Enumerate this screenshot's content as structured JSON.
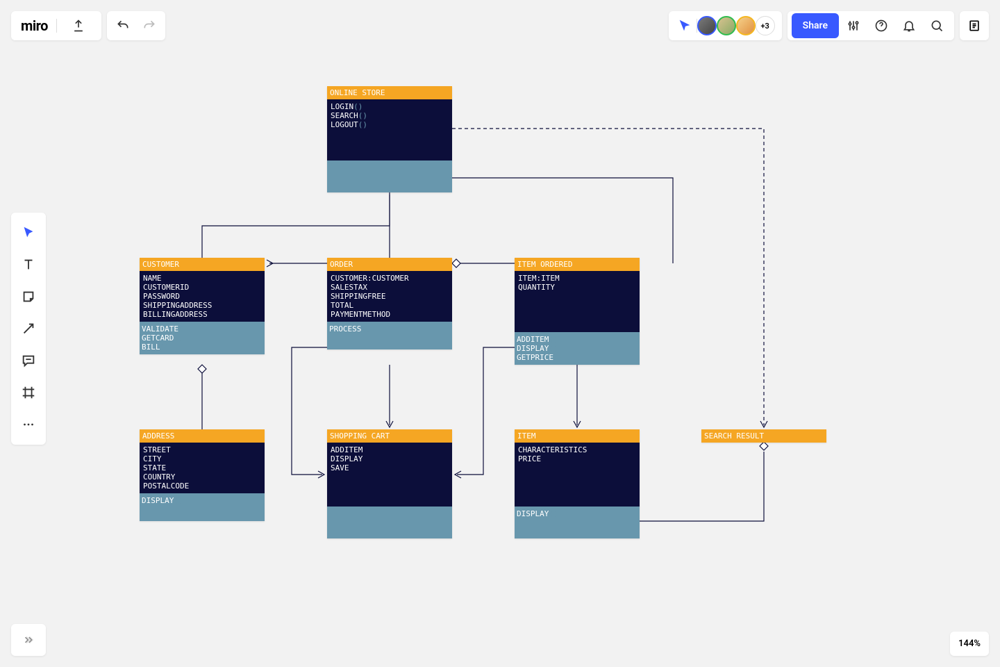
{
  "header": {
    "logo": "miro",
    "more_avatars": "+3",
    "share_label": "Share"
  },
  "zoom": "144%",
  "entities": {
    "online_store": {
      "title": "ONLINE STORE",
      "attrs": [
        "LOGIN()",
        "SEARCH()",
        "LOGOUT()"
      ],
      "methods": []
    },
    "customer": {
      "title": "CUSTOMER",
      "attrs": [
        "NAME",
        "CUSTOMERID",
        "PASSWORD",
        "SHIPPINGADDRESS",
        "BILLINGADDRESS"
      ],
      "methods": [
        "VALIDATE()",
        "GETCARD()",
        "BILL()"
      ]
    },
    "order": {
      "title": "ORDER",
      "attrs": [
        "CUSTOMER:CUSTOMER",
        "SALESTAX",
        "SHIPPINGFREE",
        "TOTAL",
        "PAYMENTMETHOD"
      ],
      "methods": [
        "PROCESS()"
      ]
    },
    "item_ordered": {
      "title": "ITEM ORDERED",
      "attrs": [
        "ITEM:ITEM",
        "QUANTITY"
      ],
      "methods": [
        "ADDITEM()",
        "DISPLAY()",
        "GETPRICE()"
      ]
    },
    "address": {
      "title": "ADDRESS",
      "attrs": [
        "STREET",
        "CITY",
        "STATE",
        "COUNTRY",
        "POSTALCODE"
      ],
      "methods": [
        "DISPLAY()"
      ]
    },
    "shopping_cart": {
      "title": "SHOPPING CART",
      "attrs": [
        "ADDITEM",
        "DISPLAY",
        "SAVE"
      ],
      "methods": []
    },
    "item": {
      "title": "ITEM",
      "attrs": [
        "CHARACTERISTICS",
        "PRICE"
      ],
      "methods": [
        "DISPLAY()"
      ]
    },
    "search_result": {
      "title": "SEARCH RESULT",
      "attrs": [],
      "methods": []
    }
  }
}
